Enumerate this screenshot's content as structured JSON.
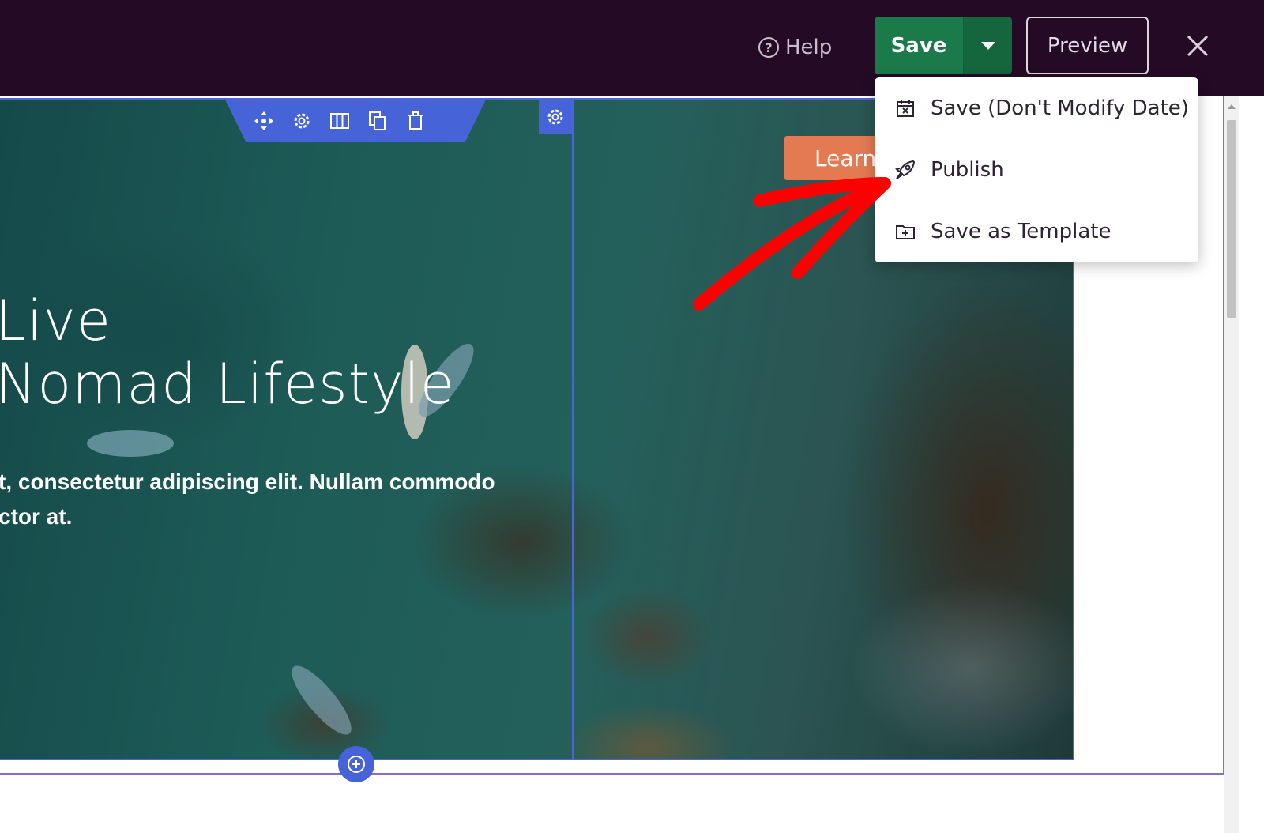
{
  "topbar": {
    "help_label": "Help",
    "save_label": "Save",
    "preview_label": "Preview"
  },
  "save_menu": {
    "items": [
      {
        "label": "Save (Don't Modify Date)",
        "icon": "calendar-x-icon"
      },
      {
        "label": "Publish",
        "icon": "rocket-icon"
      },
      {
        "label": "Save as Template",
        "icon": "folder-plus-icon"
      }
    ]
  },
  "hero": {
    "title": "Live\nNomad Lifestyle",
    "text": "t, consectetur adipiscing elit. Nullam commodo\nctor at.",
    "button_label": "Learn"
  },
  "colors": {
    "topbar_bg": "#250a26",
    "save_green": "#1b7a4a",
    "editor_blue": "#4763d8",
    "annotation_red": "#ff0000",
    "button_orange": "#e37a52"
  }
}
